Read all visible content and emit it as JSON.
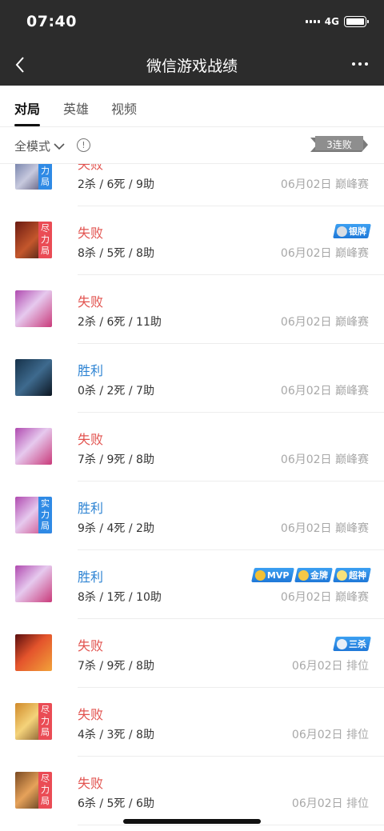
{
  "status_bar": {
    "time": "07:40",
    "network": "4G"
  },
  "nav": {
    "title": "微信游戏战绩"
  },
  "tabs": [
    {
      "label": "对局",
      "active": true
    },
    {
      "label": "英雄",
      "active": false
    },
    {
      "label": "视频",
      "active": false
    }
  ],
  "filter": {
    "mode": "全模式",
    "info": "!",
    "streak": "3连败"
  },
  "colors": {
    "lose": "#e2534f",
    "win": "#2d83d3",
    "tag_red": "#ea4c55",
    "tag_blue": "#2f8ae5",
    "header_bg": "#2c2c2c"
  },
  "matches": [
    {
      "result": "失败",
      "kda": "2杀 / 6死 / 9助",
      "date": "06月02日",
      "mode": "巅峰赛",
      "tag": "实力局",
      "tag_color": "blue",
      "medals": []
    },
    {
      "result": "失败",
      "kda": "8杀 / 5死 / 8助",
      "date": "06月02日",
      "mode": "巅峰赛",
      "tag": "尽力局",
      "tag_color": "red",
      "medals": [
        {
          "label": "银牌",
          "icon": "silver-medal-icon"
        }
      ]
    },
    {
      "result": "失败",
      "kda": "2杀 / 6死 / 11助",
      "date": "06月02日",
      "mode": "巅峰赛",
      "tag": "",
      "tag_color": "",
      "medals": []
    },
    {
      "result": "胜利",
      "kda": "0杀 / 2死 / 7助",
      "date": "06月02日",
      "mode": "巅峰赛",
      "tag": "",
      "tag_color": "",
      "medals": []
    },
    {
      "result": "失败",
      "kda": "7杀 / 9死 / 8助",
      "date": "06月02日",
      "mode": "巅峰赛",
      "tag": "",
      "tag_color": "",
      "medals": []
    },
    {
      "result": "胜利",
      "kda": "9杀 / 4死 / 2助",
      "date": "06月02日",
      "mode": "巅峰赛",
      "tag": "实力局",
      "tag_color": "blue",
      "medals": []
    },
    {
      "result": "胜利",
      "kda": "8杀 / 1死 / 10助",
      "date": "06月02日",
      "mode": "巅峰赛",
      "tag": "",
      "tag_color": "",
      "medals": [
        {
          "label": "MVP",
          "icon": "mvp-trophy-icon"
        },
        {
          "label": "金牌",
          "icon": "gold-medal-icon"
        },
        {
          "label": "超神",
          "icon": "sword-icon"
        }
      ]
    },
    {
      "result": "失败",
      "kda": "7杀 / 9死 / 8助",
      "date": "06月02日",
      "mode": "排位",
      "tag": "",
      "tag_color": "",
      "medals": [
        {
          "label": "三杀",
          "icon": "triple-kill-icon"
        }
      ]
    },
    {
      "result": "失败",
      "kda": "4杀 / 3死 / 8助",
      "date": "06月02日",
      "mode": "排位",
      "tag": "尽力局",
      "tag_color": "red",
      "medals": []
    },
    {
      "result": "失败",
      "kda": "6杀 / 5死 / 6助",
      "date": "06月02日",
      "mode": "排位",
      "tag": "尽力局",
      "tag_color": "red",
      "medals": []
    }
  ]
}
